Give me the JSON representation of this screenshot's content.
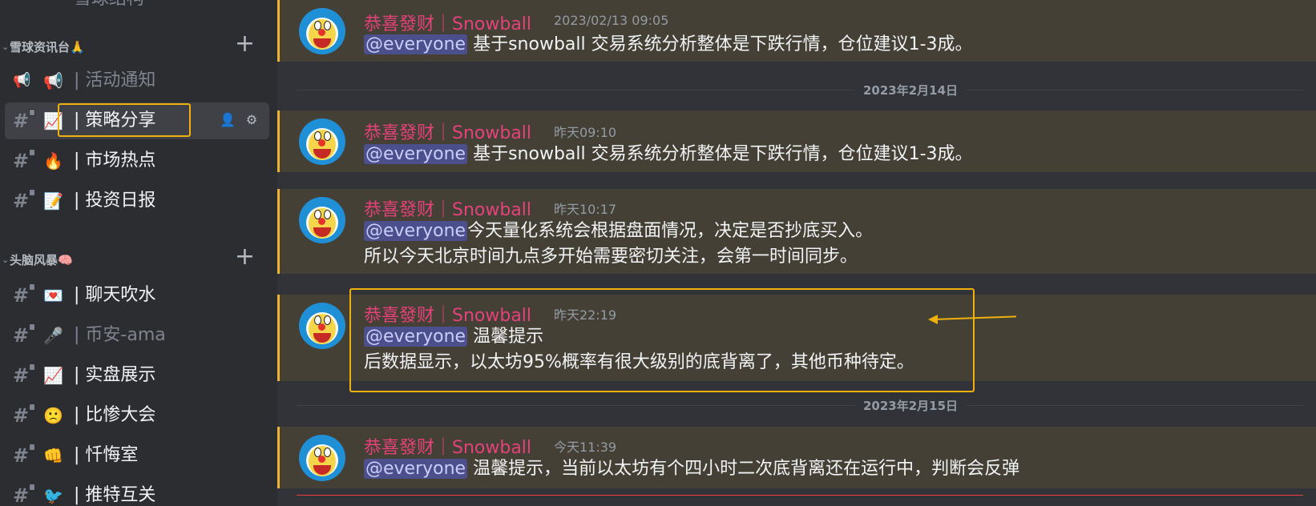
{
  "sidebar": {
    "top_partial": "雪球结构",
    "cat1": {
      "name": "雪球资讯台🙏",
      "add": "+"
    },
    "cat2": {
      "name": "头脑风暴🧠",
      "add": "+"
    },
    "channels": [
      {
        "emoji": "📢",
        "name": "| 活动通知",
        "icon": "megaphone-icon"
      },
      {
        "emoji": "📈",
        "name": "| 策略分享",
        "icon": "hash-icon"
      },
      {
        "emoji": "🔥",
        "name": "| 市场热点",
        "icon": "hash-icon"
      },
      {
        "emoji": "📝",
        "name": "| 投资日报",
        "icon": "hash-icon"
      },
      {
        "emoji": "💌",
        "name": "| 聊天吹水",
        "icon": "hash-icon"
      },
      {
        "emoji": "🎤",
        "name": "| 币安-ama",
        "icon": "hash-icon"
      },
      {
        "emoji": "📈",
        "name": "| 实盘展示",
        "icon": "hash-icon"
      },
      {
        "emoji": "🙁",
        "name": "| 比惨大会",
        "icon": "hash-icon"
      },
      {
        "emoji": "👊",
        "name": "| 忏悔室",
        "icon": "hash-icon"
      },
      {
        "emoji": "🐦",
        "name": "| 推特互关",
        "icon": "hash-icon"
      }
    ]
  },
  "messages": [
    {
      "author": "恭喜發财｜Snowball",
      "time": "2023/02/13 09:05",
      "mention": "@everyone",
      "lines": [
        "基于snowball 交易系统分析整体是下跌行情，仓位建议1-3成。"
      ]
    },
    {
      "author": "恭喜發财｜Snowball",
      "time": "昨天09:10",
      "mention": "@everyone",
      "lines": [
        "基于snowball 交易系统分析整体是下跌行情，仓位建议1-3成。"
      ]
    },
    {
      "author": "恭喜發财｜Snowball",
      "time": "昨天10:17",
      "mention": "@everyone",
      "lines": [
        "今天量化系统会根据盘面情况，决定是否抄底买入。",
        "所以今天北京时间九点多开始需要密切关注，会第一时间同步。"
      ]
    },
    {
      "author": "恭喜發财｜Snowball",
      "time": "昨天22:19",
      "mention": "@everyone",
      "lines": [
        "温馨提示",
        "后数据显示，以太坊95%概率有很大级别的底背离了，其他币种待定。"
      ]
    },
    {
      "author": "恭喜發财｜Snowball",
      "time": "今天11:39",
      "mention": "@everyone",
      "lines": [
        "温馨提示，当前以太坊有个四小时二次底背离还在运行中，判断会反弹"
      ]
    }
  ],
  "dividers": [
    "2023年2月14日",
    "2023年2月15日"
  ],
  "colors": {
    "highlight": "#f0b10c",
    "author": "#e3427a",
    "mention_bg": "#4b4f8c"
  }
}
